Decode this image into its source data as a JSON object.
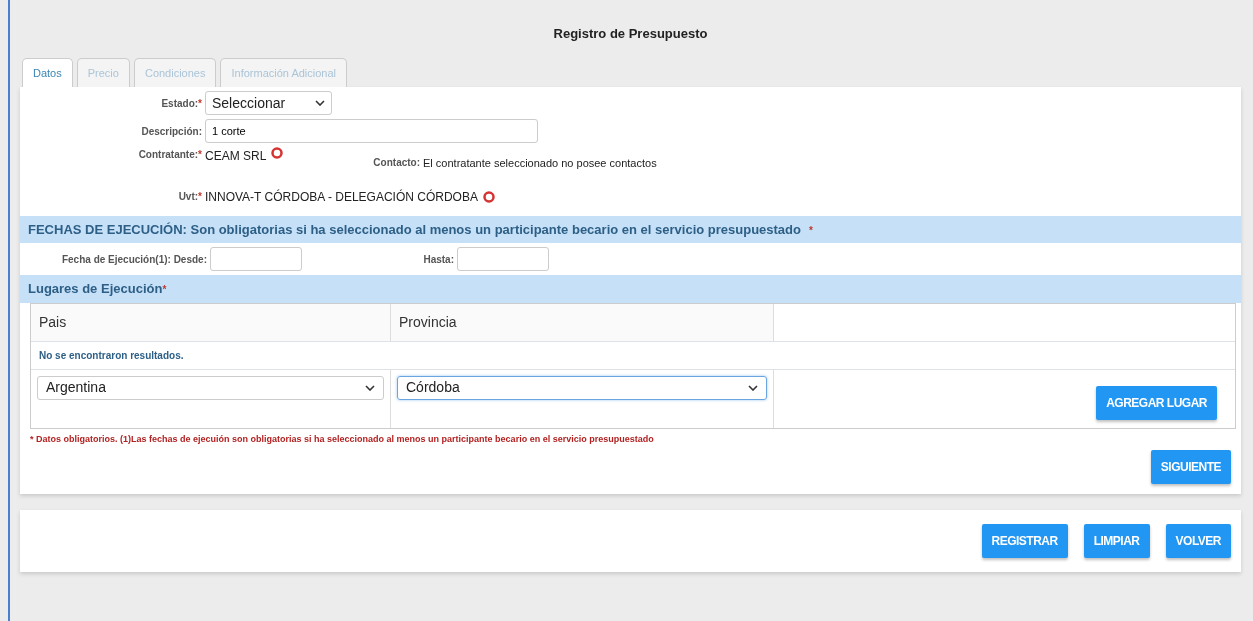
{
  "title": "Registro de Presupuesto",
  "tabs": [
    {
      "label": "Datos",
      "selected": true
    },
    {
      "label": "Precio",
      "selected": false
    },
    {
      "label": "Condiciones",
      "selected": false
    },
    {
      "label": "Información Adicional",
      "selected": false
    }
  ],
  "estado": {
    "label": "Estado:",
    "mark": "*",
    "value": "Seleccionar"
  },
  "descripcion": {
    "label": "Descripción:",
    "value": "1 corte"
  },
  "contratante": {
    "label": "Contratante:",
    "mark": "*",
    "value": "CEAM SRL"
  },
  "contacto": {
    "label": "Contacto:",
    "value": "El contratante seleccionado no posee contactos"
  },
  "uvt": {
    "label": "Uvt:",
    "mark": "*",
    "value": "INNOVA-T CÓRDOBA - DELEGACIÓN CÓRDOBA"
  },
  "fechas": {
    "heading": "FECHAS DE EJECUCIÓN: Son obligatorias si ha seleccionado al menos un participante becario en el servicio presupuestado",
    "mark": "*",
    "desde_label": "Fecha de Ejecución(1): Desde:",
    "hasta_label": "Hasta:"
  },
  "lugares": {
    "heading": "Lugares de Ejecución",
    "mark": "*",
    "columns": [
      "Pais",
      "Provincia"
    ],
    "empty": "No se encontraron resultados.",
    "pais": "Argentina",
    "provincia": "Córdoba",
    "add_button": "AGREGAR LUGAR"
  },
  "note": "* Datos obligatorios. (1)Las fechas de ejecuión son obligatorias si ha seleccionado al menos un participante becario en el servicio presupuestado",
  "next_button": "SIGUIENTE",
  "footer_buttons": [
    "REGISTRAR",
    "LIMPIAR",
    "VOLVER"
  ]
}
